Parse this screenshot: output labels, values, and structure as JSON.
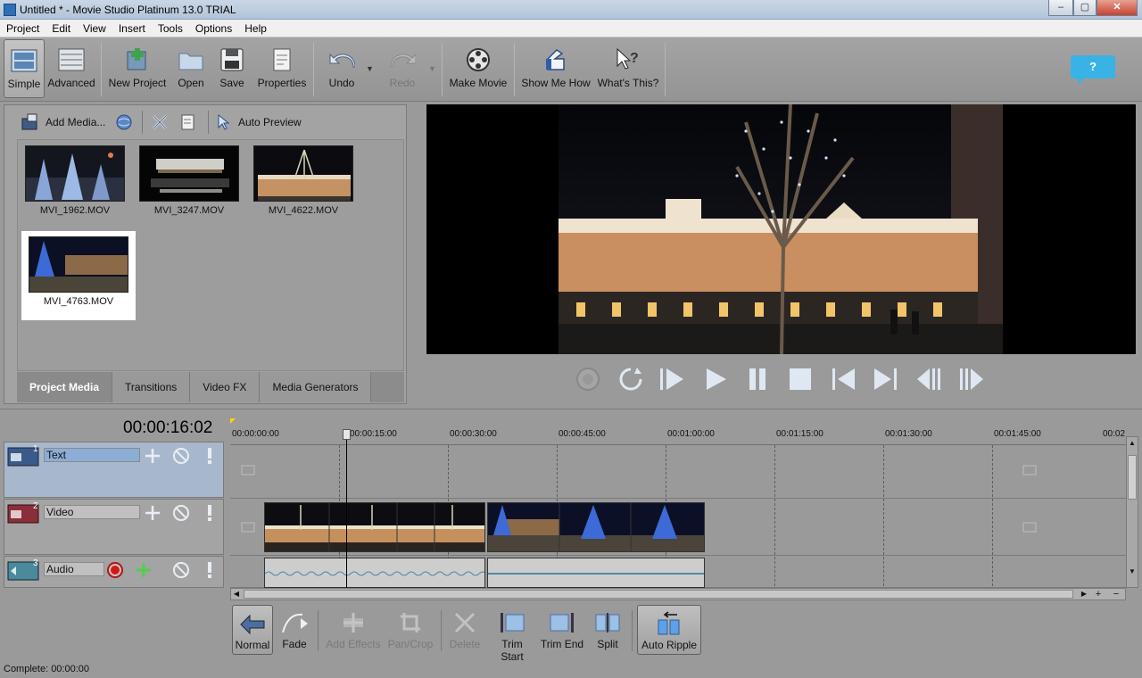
{
  "window": {
    "title": "Untitled * - Movie Studio Platinum 13.0 TRIAL",
    "min": "–",
    "max": "▢",
    "close": "✕"
  },
  "menu": [
    "Project",
    "Edit",
    "View",
    "Insert",
    "Tools",
    "Options",
    "Help"
  ],
  "toolbar": {
    "simple": "Simple",
    "advanced": "Advanced",
    "new_project": "New Project",
    "open": "Open",
    "save": "Save",
    "properties": "Properties",
    "undo": "Undo",
    "redo": "Redo",
    "make_movie": "Make Movie",
    "show_me_how": "Show Me How",
    "whats_this": "What's This?",
    "help": "?"
  },
  "media": {
    "add_media": "Add Media...",
    "auto_preview": "Auto Preview",
    "items": [
      "MVI_1962.MOV",
      "MVI_3247.MOV",
      "MVI_4622.MOV",
      "MVI_4763.MOV"
    ],
    "tabs": [
      "Project Media",
      "Transitions",
      "Video FX",
      "Media Generators"
    ]
  },
  "timeline": {
    "timecode": "00:00:16:02",
    "tracks": [
      {
        "num": "1",
        "name": "Text"
      },
      {
        "num": "2",
        "name": "Video"
      },
      {
        "num": "3",
        "name": "Audio"
      }
    ],
    "ruler": [
      "00:00:00:00",
      "00:00:15:00",
      "00:00:30:00",
      "00:00:45:00",
      "00:01:00:00",
      "00:01:15:00",
      "00:01:30:00",
      "00:01:45:00",
      "00:02"
    ]
  },
  "edit_tools": {
    "normal": "Normal",
    "fade": "Fade",
    "add_effects": "Add Effects",
    "pan_crop": "Pan/Crop",
    "delete": "Delete",
    "trim_start": "Trim Start",
    "trim_end": "Trim End",
    "split": "Split",
    "auto_ripple": "Auto Ripple"
  },
  "status": "Complete: 00:00:00",
  "colors": {
    "accent": "#39b3e6",
    "video_track": "#8a2f3a",
    "audio_track": "#4a8a9a",
    "text_track": "#3a5a8a"
  }
}
